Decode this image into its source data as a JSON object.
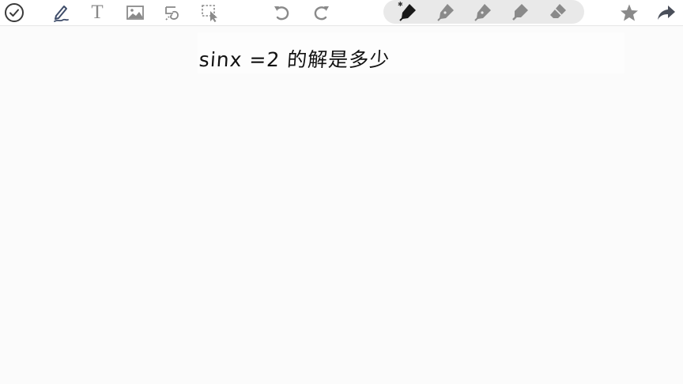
{
  "toolbar": {
    "left_tools": [
      {
        "name": "done",
        "icon": "check-circle-icon"
      },
      {
        "name": "pen",
        "icon": "handwriting-pen-icon"
      },
      {
        "name": "text",
        "icon": "text-t-icon",
        "glyph": "T"
      },
      {
        "name": "image",
        "icon": "image-icon"
      },
      {
        "name": "lasso",
        "icon": "lasso-icon"
      },
      {
        "name": "select",
        "icon": "dashed-select-icon"
      }
    ],
    "history": [
      {
        "name": "undo",
        "icon": "undo-icon"
      },
      {
        "name": "redo",
        "icon": "redo-icon"
      }
    ],
    "pen_tray": {
      "bluetooth_glyph": "✱",
      "pens": [
        {
          "name": "active-pen",
          "icon": "pen-nib-icon",
          "color": "#1a1a1a",
          "active": true
        },
        {
          "name": "pen-2",
          "icon": "pen-nib-icon",
          "color": "#8a8a8a",
          "active": false
        },
        {
          "name": "pen-3",
          "icon": "pen-nib-icon",
          "color": "#8a8a8a",
          "active": false
        },
        {
          "name": "highlighter",
          "icon": "highlighter-icon",
          "color": "#8a8a8a",
          "active": false
        },
        {
          "name": "eraser",
          "icon": "eraser-icon",
          "color": "#8a8a8a",
          "active": false
        }
      ]
    },
    "right_tools": [
      {
        "name": "favorite",
        "icon": "star-icon"
      },
      {
        "name": "share",
        "icon": "share-arrow-icon"
      }
    ]
  },
  "canvas": {
    "handwritten_text": "sinx =2 的解是多少"
  },
  "colors": {
    "icon_gray": "#8a8a8a",
    "icon_dark": "#1a1a1a",
    "tray_bg": "#e9e9e9",
    "ink": "#111111"
  }
}
